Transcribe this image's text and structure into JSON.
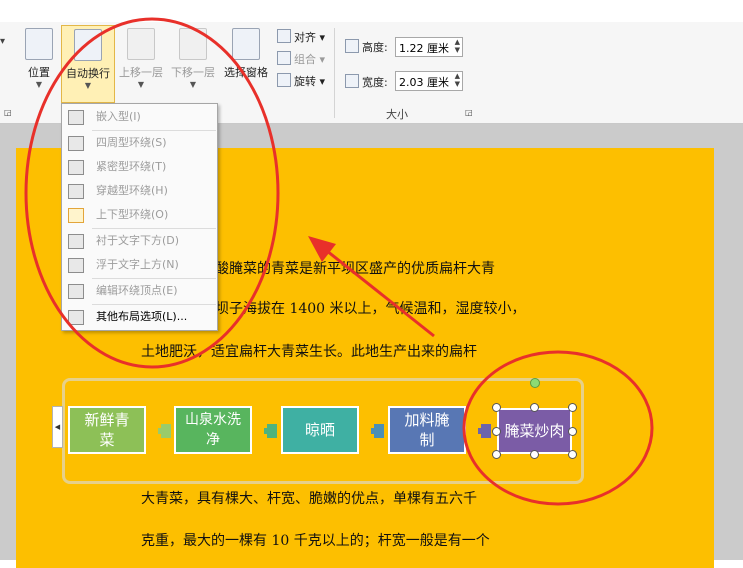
{
  "ribbon": {
    "position": "位置",
    "wrap_text": "自动换行",
    "bring_forward": "上移一层",
    "send_backward": "下移一层",
    "selection_pane": "选择窗格",
    "align": "对齐",
    "group": "组合",
    "rotate": "旋转",
    "height_label": "高度:",
    "height_value": "1.22 厘米",
    "width_label": "宽度:",
    "width_value": "2.03 厘米",
    "size_group": "大小"
  },
  "menu": {
    "items": [
      {
        "label": "嵌入型(I)",
        "enabled": false
      },
      {
        "label": "四周型环绕(S)",
        "enabled": false
      },
      {
        "label": "紧密型环绕(T)",
        "enabled": false
      },
      {
        "label": "穿越型环绕(H)",
        "enabled": false
      },
      {
        "label": "上下型环绕(O)",
        "enabled": false
      },
      {
        "label": "衬于文字下方(D)",
        "enabled": false
      },
      {
        "label": "浮于文字上方(N)",
        "enabled": false
      },
      {
        "label": "编辑环绕顶点(E)",
        "enabled": false
      },
      {
        "label": "其他布局选项(L)...",
        "enabled": true
      }
    ]
  },
  "document": {
    "lines": [
      "酸腌菜的青菜是新平坝区盛产的优质扁杆大青",
      "坝子海拔在 1400 米以上，气候温和，湿度较小，",
      "土地肥沃，适宜扁杆大青菜生长。此地生产出来的扁杆",
      "大青菜，具有棵大、杆宽、脆嫩的优点，单棵有五六千",
      "克重，最大的一棵有 10 千克以上的；杆宽一般是有一个"
    ]
  },
  "smartart": {
    "nodes": [
      {
        "line1": "新鲜青",
        "line2": "菜",
        "color": "#8dc057"
      },
      {
        "line1": "山泉水洗",
        "line2": "净",
        "color": "#58b55e"
      },
      {
        "line1": "晾晒",
        "line2": "",
        "color": "#3fb0a3"
      },
      {
        "line1": "加料腌",
        "line2": "制",
        "color": "#5877b4"
      },
      {
        "line1": "腌菜炒肉",
        "line2": "",
        "color": "#7b5ca6"
      }
    ]
  },
  "colors": {
    "page": "#fdbf00",
    "annotation": "#e8302a"
  }
}
